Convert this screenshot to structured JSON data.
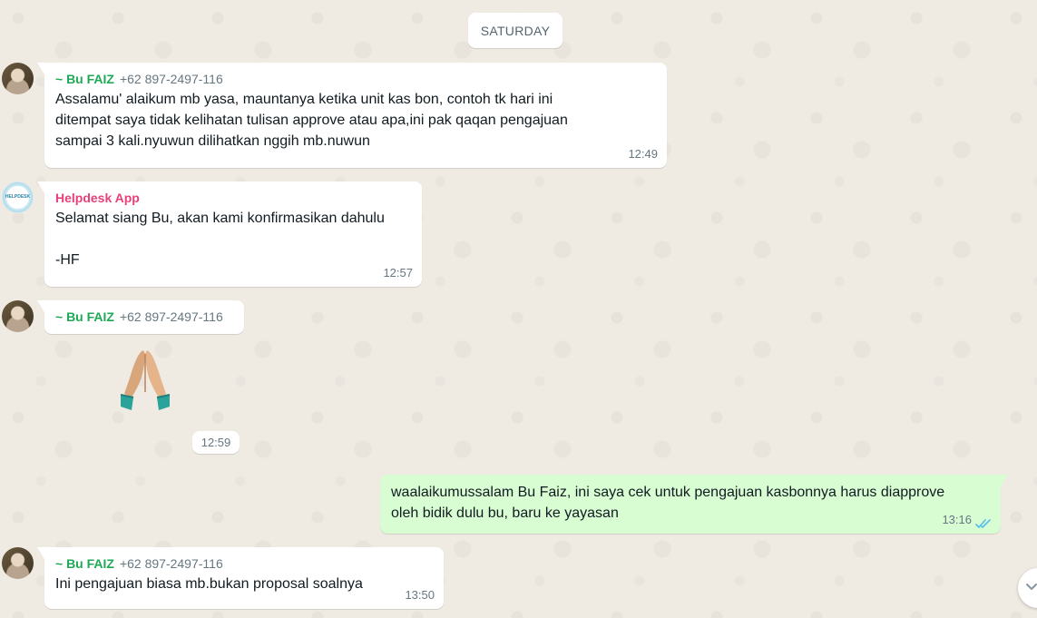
{
  "date_separator": "SATURDAY",
  "messages": [
    {
      "sender": "~ Bu FAIZ",
      "phone": "+62 897-2497-116",
      "text": "Assalamu' alaikum mb yasa, mauntanya ketika unit kas bon, contoh tk hari ini\nditempat saya tidak kelihatan tulisan approve atau apa,ini pak qaqan pengajuan\nsampai 3 kali.nyuwun dilihatkan nggih mb.nuwun",
      "time": "12:49"
    },
    {
      "sender": "Helpdesk App",
      "avatar_text": "HELPDESK",
      "text": "Selamat siang Bu, akan kami konfirmasikan dahulu\n\n-HF",
      "time": "12:57"
    },
    {
      "sender": "~ Bu FAIZ",
      "phone": "+62 897-2497-116",
      "emoji": "folded-hands-emoji",
      "time": "12:59"
    },
    {
      "direction": "outgoing",
      "text": "waalaikumussalam Bu Faiz, ini saya cek untuk pengajuan kasbonnya harus diapprove\noleh bidik dulu bu, baru ke yayasan",
      "time": "13:16",
      "status": "read"
    },
    {
      "sender": "~ Bu FAIZ",
      "phone": "+62 897-2497-116",
      "text": "Ini pengajuan biasa mb.bukan proposal soalnya",
      "time": "13:50"
    }
  ],
  "colors": {
    "background": "#efeae2",
    "incoming_bubble": "#ffffff",
    "outgoing_bubble": "#d9fdd3",
    "sender_green": "#1fa855",
    "sender_pink": "#e8407a",
    "read_ticks": "#53bdeb"
  },
  "icons": {
    "read_receipt": "double-check-icon",
    "scroll_down": "chevron-down-icon"
  }
}
